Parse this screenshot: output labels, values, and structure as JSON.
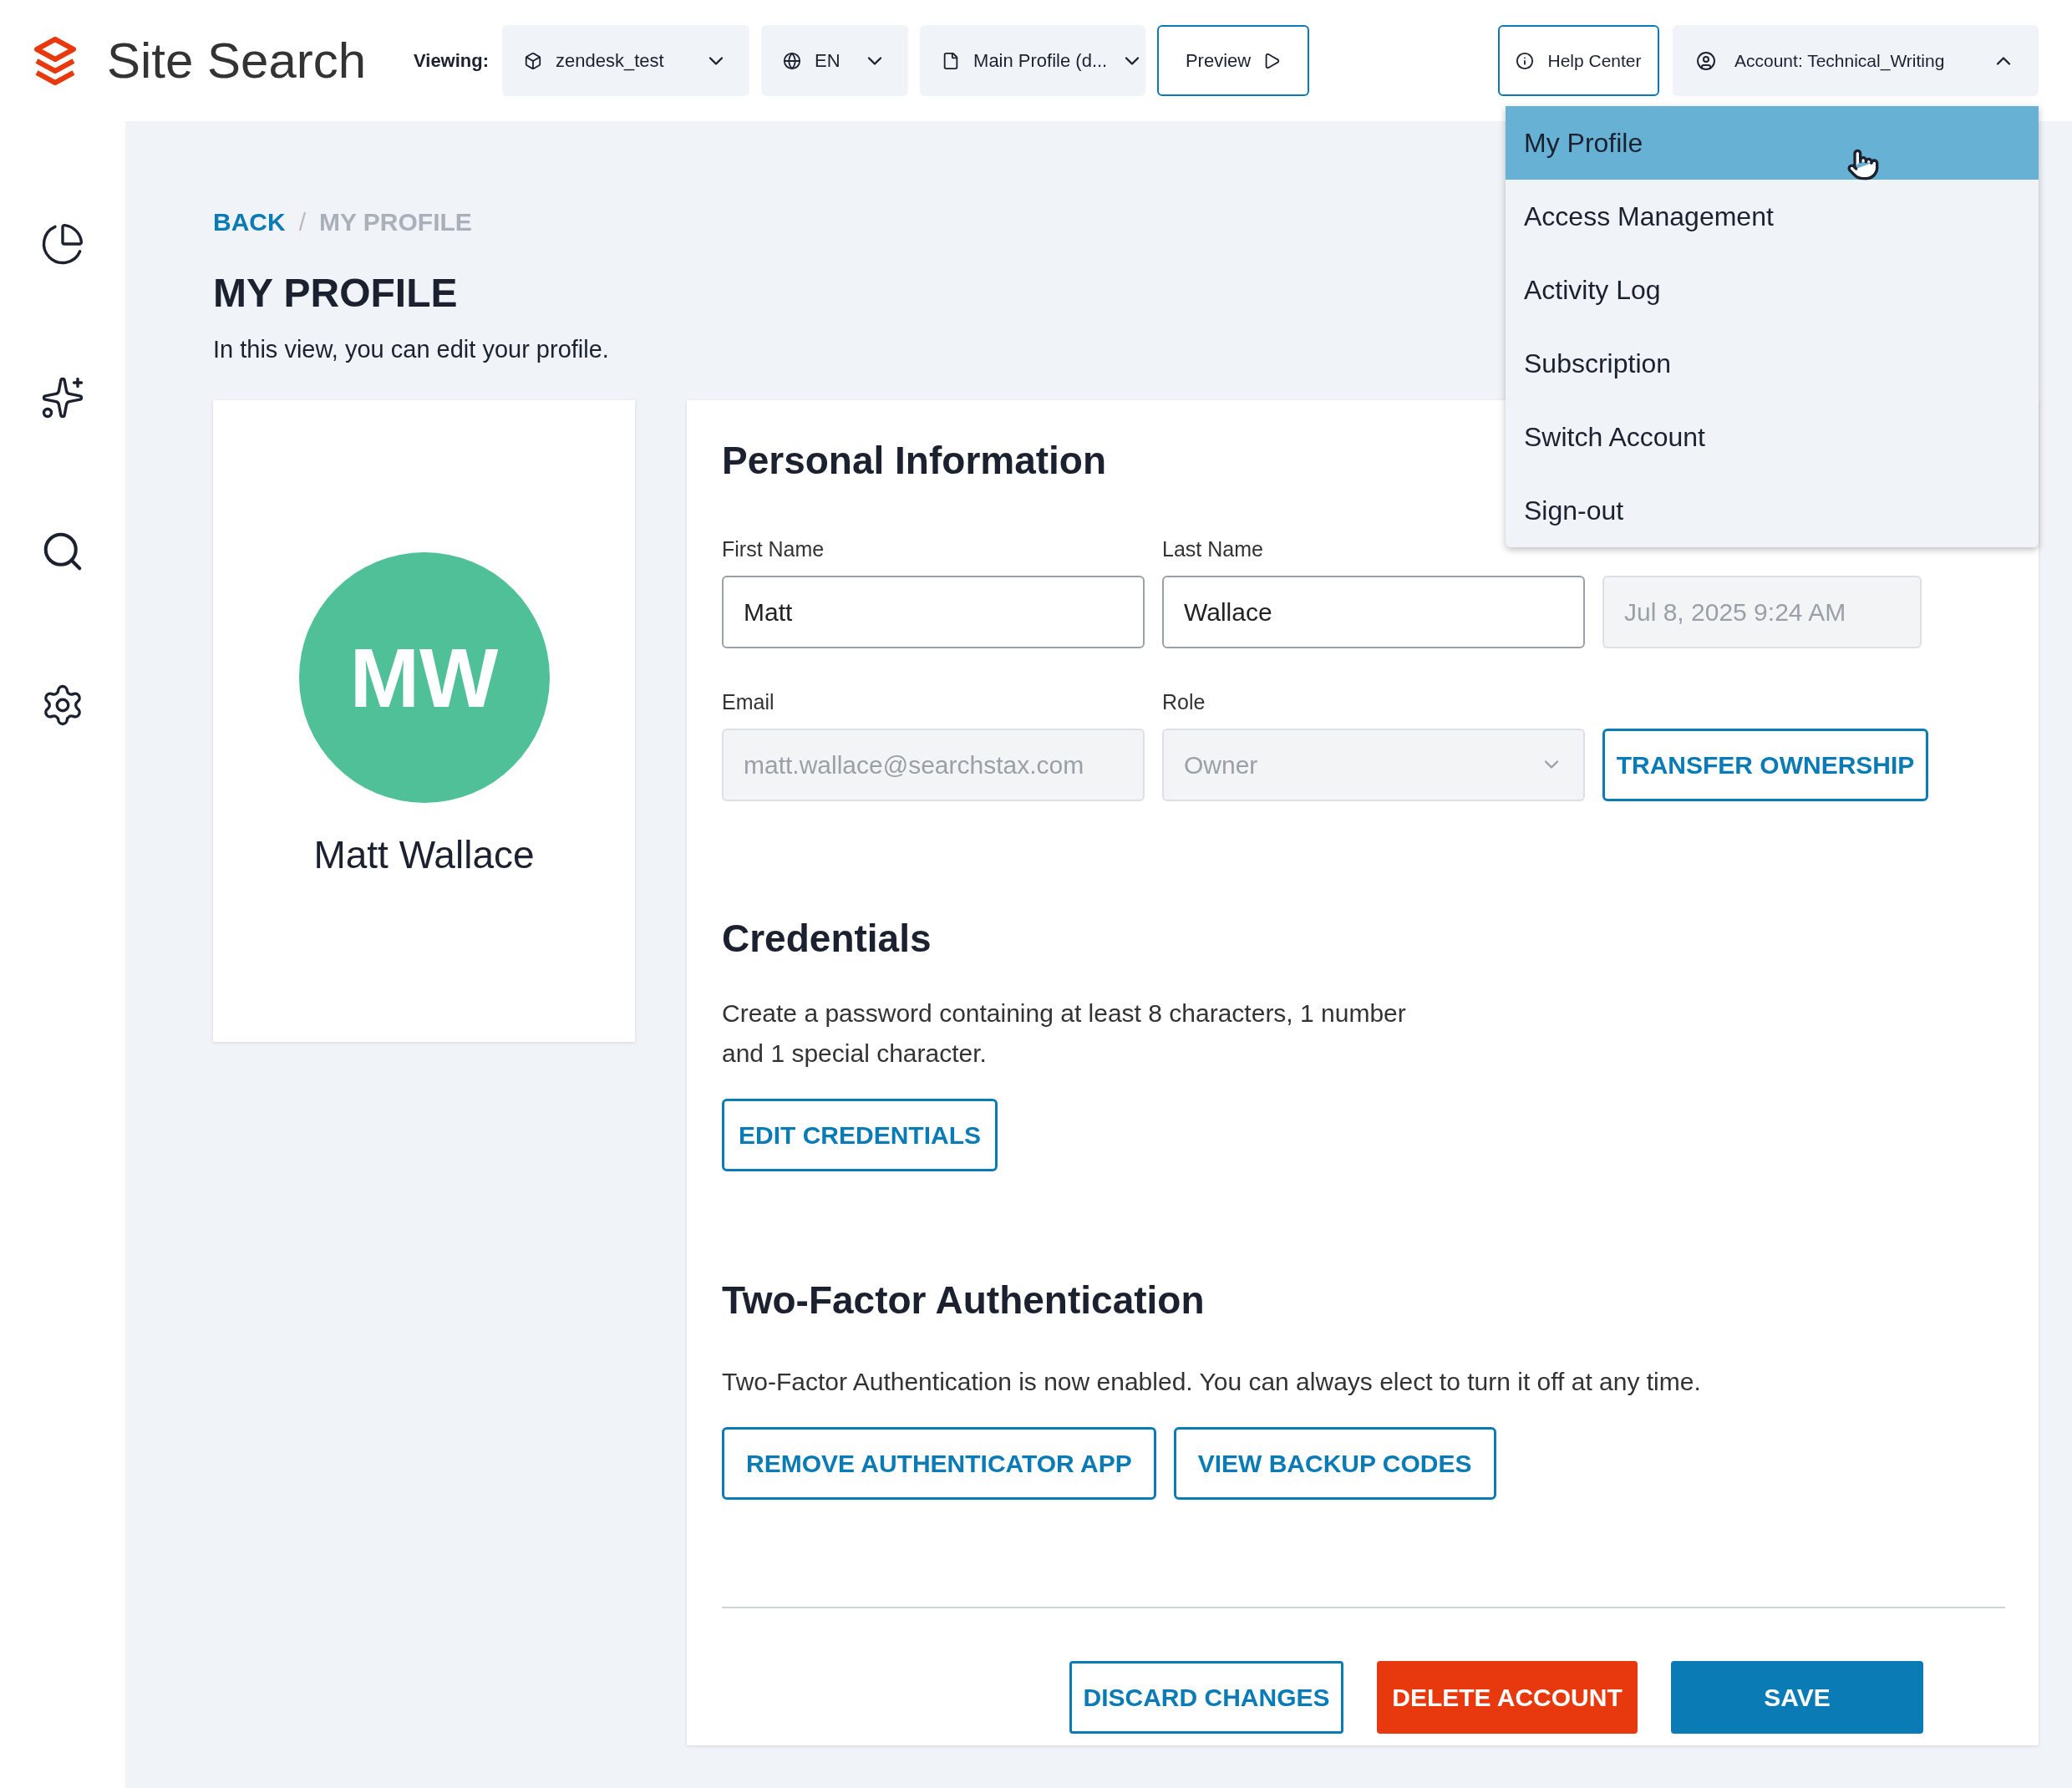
{
  "header": {
    "brand": "Site Search",
    "viewing_label": "Viewing:",
    "selectors": [
      {
        "kind": "project",
        "label": "zendesk_test"
      },
      {
        "kind": "language",
        "label": "EN"
      },
      {
        "kind": "profile",
        "label": "Main Profile (d..."
      }
    ],
    "preview_button": "Preview",
    "help_center": "Help Center",
    "account": {
      "label": "Account: Technical_Writing",
      "expanded": true
    }
  },
  "account_menu": [
    {
      "label": "My Profile",
      "selected": true
    },
    {
      "label": "Access Management",
      "selected": false
    },
    {
      "label": "Activity Log",
      "selected": false
    },
    {
      "label": "Subscription",
      "selected": false
    },
    {
      "label": "Switch Account",
      "selected": false
    },
    {
      "label": "Sign-out",
      "selected": false
    }
  ],
  "breadcrumb": {
    "separator": "/",
    "items": [
      {
        "label": "BACK",
        "link": true
      },
      {
        "label": "MY PROFILE",
        "link": false
      }
    ]
  },
  "title": "MY PROFILE",
  "subtitle": "In this view, you can edit your profile.",
  "profile_card": {
    "initials": "MW",
    "name": "Matt Wallace"
  },
  "personal_info": {
    "title": "Personal Information",
    "fields": [
      {
        "label": "First Name",
        "value": "Matt",
        "disabled": false,
        "kind": "text"
      },
      {
        "label": "Last Name",
        "value": "Wallace",
        "disabled": false,
        "kind": "text"
      },
      {
        "value": "Jul 8, 2025 9:24 AM",
        "disabled": true,
        "kind": "text"
      },
      {
        "label": "Email",
        "value": "matt.wallace@searchstax.com",
        "disabled": true,
        "kind": "text"
      },
      {
        "label": "Role",
        "value": "Owner",
        "disabled": true,
        "kind": "select"
      }
    ],
    "transfer_button": "TRANSFER OWNERSHIP"
  },
  "credentials": {
    "title": "Credentials",
    "text": "Create a password containing at least 8 characters, 1 number and 1 special character.",
    "button": "EDIT CREDENTIALS"
  },
  "two_factor": {
    "title": "Two-Factor Authentication",
    "text": "Two-Factor Authentication is now enabled. You can always elect to turn it off at any time.",
    "buttons": [
      "REMOVE AUTHENTICATOR APP",
      "VIEW BACKUP CODES"
    ]
  },
  "footer_buttons": [
    {
      "label": "DISCARD CHANGES",
      "kind": "outline"
    },
    {
      "label": "DELETE ACCOUNT",
      "kind": "danger"
    },
    {
      "label": "SAVE",
      "kind": "primary"
    }
  ]
}
